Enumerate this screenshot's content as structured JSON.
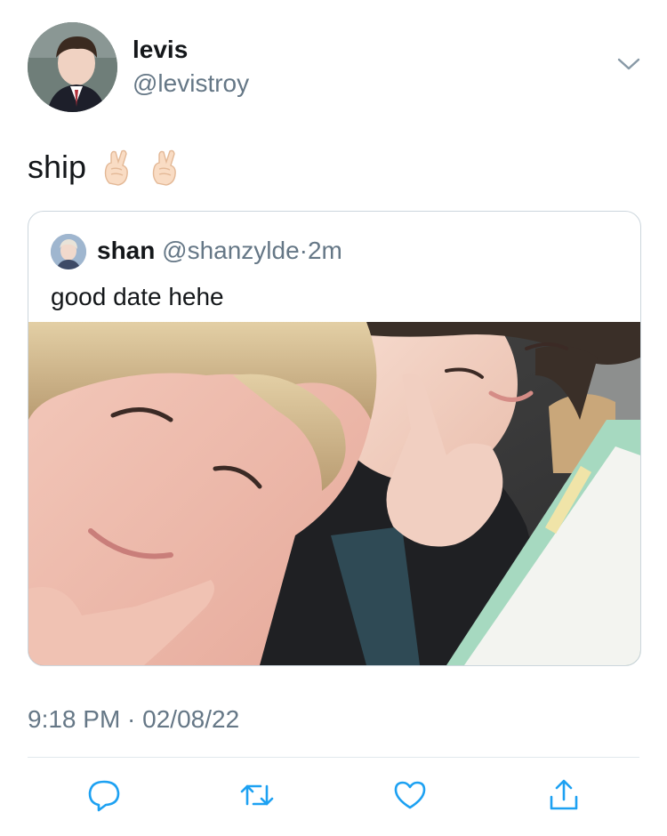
{
  "author": {
    "display_name": "levis",
    "handle": "@levistroy",
    "avatar": "profile-photo"
  },
  "tweet": {
    "text": "ship",
    "emoji": [
      "crossed-fingers-emoji",
      "crossed-fingers-emoji"
    ]
  },
  "quoted_tweet": {
    "display_name": "shan",
    "handle": "@shanzylde",
    "separator": "·",
    "time_ago": "2m",
    "text": "good date hehe",
    "media": "selfie-photo"
  },
  "timestamp": "9:18 PM · 02/08/22",
  "actions": [
    {
      "name": "reply",
      "icon": "reply-icon"
    },
    {
      "name": "retweet",
      "icon": "retweet-icon"
    },
    {
      "name": "like",
      "icon": "heart-icon"
    },
    {
      "name": "share",
      "icon": "share-icon"
    }
  ],
  "colors": {
    "text_primary": "#14171a",
    "text_secondary": "#657786",
    "border": "#ccd6dd",
    "icon": "#1da1f2"
  }
}
